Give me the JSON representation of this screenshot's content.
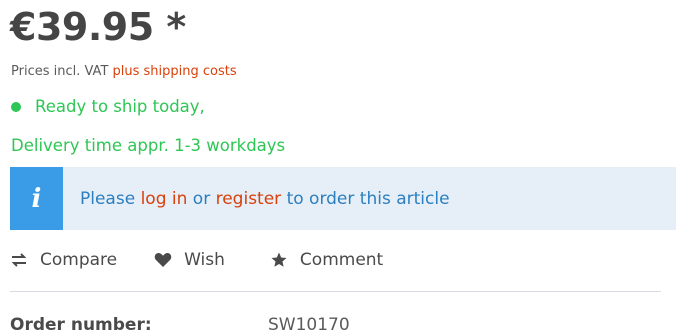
{
  "price": {
    "value": "€39.95 *"
  },
  "vat": {
    "prefix": "Prices incl. VAT ",
    "shipping_link": "plus shipping costs"
  },
  "availability": {
    "status": "Ready to ship today,",
    "delivery": "Delivery time appr. 1-3 workdays",
    "color": "#2ec654"
  },
  "notice": {
    "icon": "info-icon",
    "icon_glyph": "i",
    "text_before": "Please ",
    "login_link": "log in",
    "text_middle": " or ",
    "register_link": "register",
    "text_after": " to order this article"
  },
  "actions": {
    "compare": {
      "label": "Compare",
      "icon": "compare-arrows-icon"
    },
    "wish": {
      "label": "Wish",
      "icon": "heart-icon"
    },
    "comment": {
      "label": "Comment",
      "icon": "star-icon"
    }
  },
  "details": {
    "order_number_label": "Order number:",
    "order_number_value": "SW10170"
  },
  "colors": {
    "accent_red": "#d9400b",
    "info_blue": "#3a9be6",
    "info_bg": "#e6eff7"
  }
}
